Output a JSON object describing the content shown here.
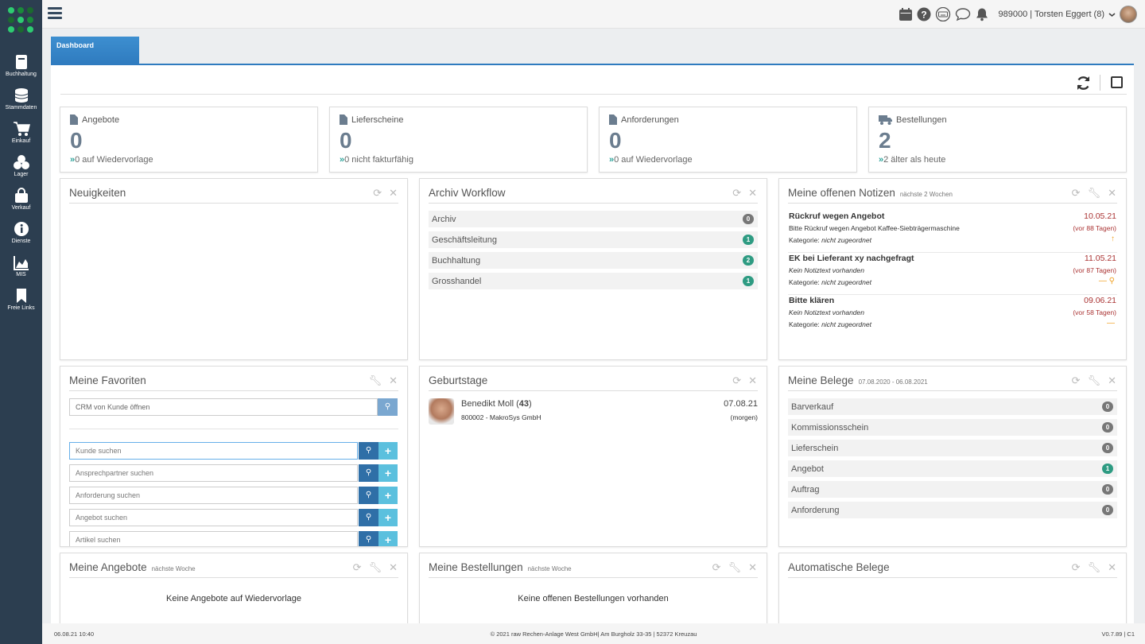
{
  "colors": {
    "sidebar": "#2c3e50",
    "accent": "#2f7bbf",
    "badge_green": "#2e9b82",
    "badge_grey": "#777777",
    "link_green": "#2aa198"
  },
  "sidebar": {
    "items": [
      {
        "label": "Buchhaltung",
        "icon": "book-icon"
      },
      {
        "label": "Stammdaten",
        "icon": "database-icon"
      },
      {
        "label": "Einkauf",
        "icon": "cart-icon"
      },
      {
        "label": "Lager",
        "icon": "boxes-icon"
      },
      {
        "label": "Verkauf",
        "icon": "bag-icon"
      },
      {
        "label": "Dienste",
        "icon": "info-icon"
      },
      {
        "label": "MIS",
        "icon": "area-chart-icon"
      },
      {
        "label": "Freie Links",
        "icon": "bookmark-icon"
      }
    ]
  },
  "header": {
    "user": "989000 | Torsten Eggert (8)"
  },
  "tab": {
    "label": "Dashboard"
  },
  "stats": [
    {
      "title": "Angebote",
      "value": "0",
      "arrow": "»",
      "sub": "0 auf Wiedervorlage"
    },
    {
      "title": "Lieferscheine",
      "value": "0",
      "arrow": "»",
      "sub": "0 nicht fakturfähig"
    },
    {
      "title": "Anforderungen",
      "value": "0",
      "arrow": "»",
      "sub": "0 auf Wiedervorlage"
    },
    {
      "title": "Bestellungen",
      "value": "2",
      "arrow": "»",
      "sub": "2 älter als heute"
    }
  ],
  "panels": {
    "news": {
      "title": "Neuigkeiten"
    },
    "archive": {
      "title": "Archiv Workflow",
      "rows": [
        {
          "label": "Archiv",
          "count": "0"
        },
        {
          "label": "Geschäftsleitung",
          "count": "1"
        },
        {
          "label": "Buchhaltung",
          "count": "2"
        },
        {
          "label": "Grosshandel",
          "count": "1"
        }
      ]
    },
    "notes": {
      "title": "Meine offenen Notizen",
      "subtitle": "nächste 2 Wochen",
      "items": [
        {
          "title": "Rückruf wegen Angebot",
          "date": "10.05.21",
          "text": "Bitte Rückruf wegen Angebot Kaffee-Siebträgermaschine",
          "ago": "(vor 88 Tagen)",
          "cat_label": "Kategorie:",
          "cat": "nicht zugeordnet",
          "icon": "↑"
        },
        {
          "title": "EK bei Lieferant xy nachgefragt",
          "date": "11.05.21",
          "text": "Kein Notiztext vorhanden",
          "ago": "(vor 87 Tagen)",
          "cat_label": "Kategorie:",
          "cat": "nicht zugeordnet",
          "icon": "— ⚲"
        },
        {
          "title": "Bitte klären",
          "date": "09.06.21",
          "text": "Kein Notiztext vorhanden",
          "ago": "(vor 58 Tagen)",
          "cat_label": "Kategorie:",
          "cat": "nicht zugeordnet",
          "icon": "—"
        }
      ]
    },
    "favorites": {
      "title": "Meine Favoriten",
      "crm_placeholder": "CRM von Kunde öffnen",
      "searches": [
        "Kunde suchen",
        "Ansprechpartner suchen",
        "Anforderung suchen",
        "Angebot suchen",
        "Artikel suchen"
      ]
    },
    "birthdays": {
      "title": "Geburtstage",
      "person": {
        "name": "Benedikt Moll",
        "age": "43",
        "company": "800002 - MakroSys GmbH",
        "date": "07.08.21",
        "when": "(morgen)"
      }
    },
    "documents": {
      "title": "Meine Belege",
      "range": "07.08.2020 - 06.08.2021",
      "rows": [
        {
          "label": "Barverkauf",
          "count": "0"
        },
        {
          "label": "Kommissionsschein",
          "count": "0"
        },
        {
          "label": "Lieferschein",
          "count": "0"
        },
        {
          "label": "Angebot",
          "count": "1"
        },
        {
          "label": "Auftrag",
          "count": "0"
        },
        {
          "label": "Anforderung",
          "count": "0"
        }
      ]
    },
    "offers": {
      "title": "Meine Angebote",
      "subtitle": "nächste Woche",
      "empty": "Keine Angebote auf Wiedervorlage"
    },
    "orders": {
      "title": "Meine Bestellungen",
      "subtitle": "nächste Woche",
      "empty": "Keine offenen Bestellungen vorhanden"
    },
    "auto": {
      "title": "Automatische Belege"
    }
  },
  "footer": {
    "datetime": "06.08.21 10:40",
    "copyright": "© 2021 raw Rechen-Anlage West GmbH| Am Burgholz 33-35 | 52372 Kreuzau",
    "version": "V0.7.89 | C1"
  }
}
